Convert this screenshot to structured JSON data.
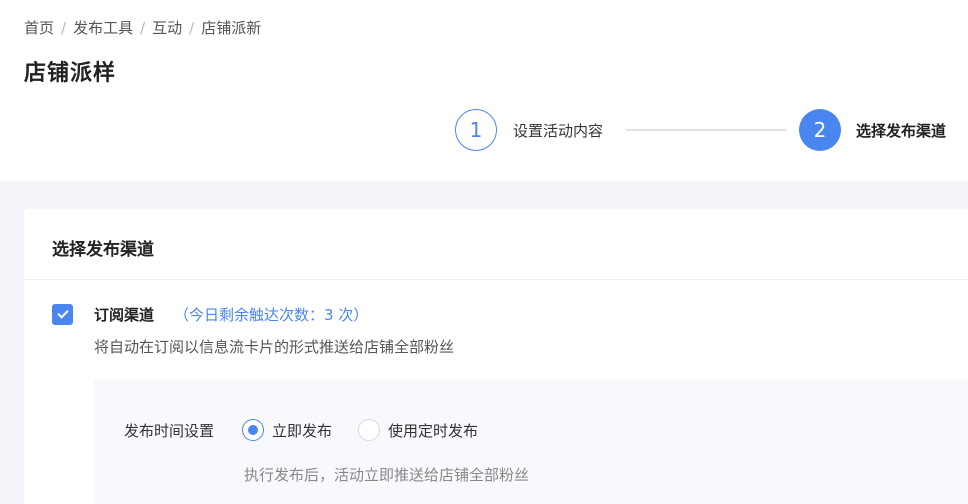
{
  "breadcrumb": {
    "items": [
      "首页",
      "发布工具",
      "互动",
      "店铺派新"
    ],
    "separator": "/"
  },
  "page": {
    "title": "店铺派样"
  },
  "steps": [
    {
      "number": "1",
      "label": "设置活动内容",
      "state": "done"
    },
    {
      "number": "2",
      "label": "选择发布渠道",
      "state": "active"
    }
  ],
  "card": {
    "title": "选择发布渠道",
    "channel": {
      "checked": true,
      "name": "订阅渠道",
      "quota": "（今日剩余触达次数：3 次）",
      "description": "将自动在订阅以信息流卡片的形式推送给店铺全部粉丝"
    },
    "publish_time": {
      "label": "发布时间设置",
      "options": [
        {
          "label": "立即发布",
          "selected": true
        },
        {
          "label": "使用定时发布",
          "selected": false
        }
      ],
      "hint": "执行发布后，活动立即推送给店铺全部粉丝"
    }
  },
  "colors": {
    "accent": "#4a86f0",
    "page_background": "#f3f5fa",
    "settings_background": "#f7f9fd"
  }
}
